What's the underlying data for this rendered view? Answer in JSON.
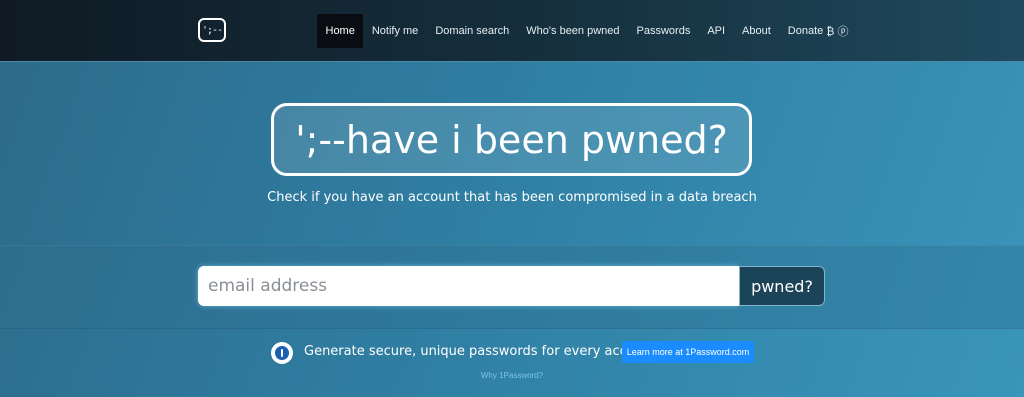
{
  "nav": {
    "logo_text": "';--",
    "items": [
      {
        "label": "Home",
        "active": true
      },
      {
        "label": "Notify me"
      },
      {
        "label": "Domain search"
      },
      {
        "label": "Who's been pwned"
      },
      {
        "label": "Passwords"
      },
      {
        "label": "API"
      },
      {
        "label": "About"
      },
      {
        "label": "Donate"
      }
    ],
    "donate_icons": "₿ ⓟ"
  },
  "hero": {
    "title": "';--have i been pwned?",
    "subtitle": "Check if you have an account that has been compromised in a data breach"
  },
  "search": {
    "placeholder": "email address",
    "value": "",
    "button_label": "pwned?"
  },
  "promo": {
    "icon": "1password-icon",
    "text": "Generate secure, unique passwords for every account",
    "button_label": "Learn more at 1Password.com",
    "link_text": "Why 1Password?"
  },
  "colors": {
    "accent_button": "#1a8cff",
    "pwned_button": "#1c4458",
    "nav_active": "#090d12"
  }
}
